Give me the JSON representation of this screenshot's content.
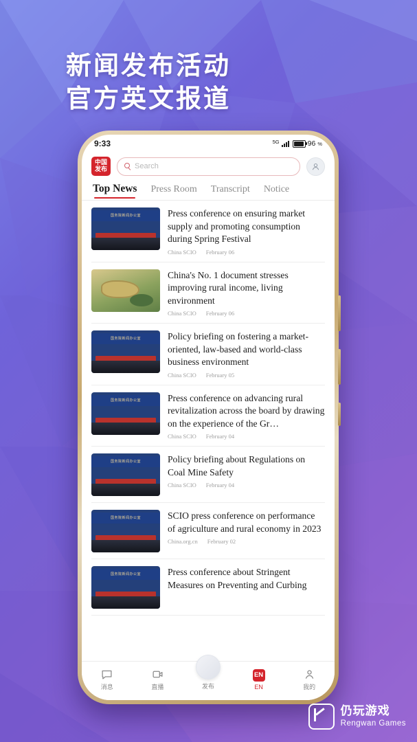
{
  "poster": {
    "headline_line1": "新闻发布活动",
    "headline_line2": "官方英文报道"
  },
  "phone": {
    "status_bar": {
      "time": "9:33",
      "network": "5G",
      "battery_text": "96",
      "battery_unit": "%"
    },
    "header": {
      "logo_line1": "中国",
      "logo_line2": "发布",
      "search_placeholder": "Search",
      "search_icon": "search-icon",
      "avatar_icon": "avatar-icon"
    },
    "tabs": [
      {
        "label": "Top News",
        "active": true
      },
      {
        "label": "Press Room",
        "active": false
      },
      {
        "label": "Transcript",
        "active": false
      },
      {
        "label": "Notice",
        "active": false
      }
    ],
    "news": [
      {
        "title": "Press conference on ensuring market supply and promoting consumption during Spring Festival",
        "source": "China SCIO",
        "date": "February 06",
        "thumb": "press-conference-photo",
        "banner": "国务院新闻办公室"
      },
      {
        "title": "China's No. 1 document stresses improving rural income, living environment",
        "source": "China SCIO",
        "date": "February 06",
        "thumb": "rural-landscape-photo",
        "banner": ""
      },
      {
        "title": "Policy briefing on fostering a market-oriented, law-based and world-class business environment",
        "source": "China SCIO",
        "date": "February 05",
        "thumb": "press-conference-photo",
        "banner": "国务院新闻办公室"
      },
      {
        "title": "Press conference on advancing rural revitalization across the board by drawing on the experience of the Gr…",
        "source": "China SCIO",
        "date": "February 04",
        "thumb": "press-conference-photo",
        "banner": "国务院新闻办公室"
      },
      {
        "title": "Policy briefing about Regulations on Coal Mine Safety",
        "source": "China SCIO",
        "date": "February 04",
        "thumb": "press-conference-photo",
        "banner": "国务院新闻办公室"
      },
      {
        "title": "SCIO press conference on performance of agriculture and rural economy in 2023",
        "source": "China.org.cn",
        "date": "February 02",
        "thumb": "press-conference-photo",
        "banner": "国务院新闻办公室"
      },
      {
        "title": "Press conference about Stringent Measures on Preventing and Curbing",
        "source": "",
        "date": "",
        "thumb": "press-conference-photo",
        "banner": "国务院新闻办公室"
      }
    ],
    "bottom_nav": [
      {
        "label": "消息",
        "icon": "message-icon"
      },
      {
        "label": "直播",
        "icon": "live-video-icon"
      },
      {
        "label": "发布",
        "icon": "publish-icon"
      },
      {
        "label": "EN",
        "icon": "en-badge-icon"
      },
      {
        "label": "我的",
        "icon": "profile-icon"
      }
    ]
  },
  "watermark": {
    "cn": "仍玩游戏",
    "en": "Rengwan Games"
  }
}
